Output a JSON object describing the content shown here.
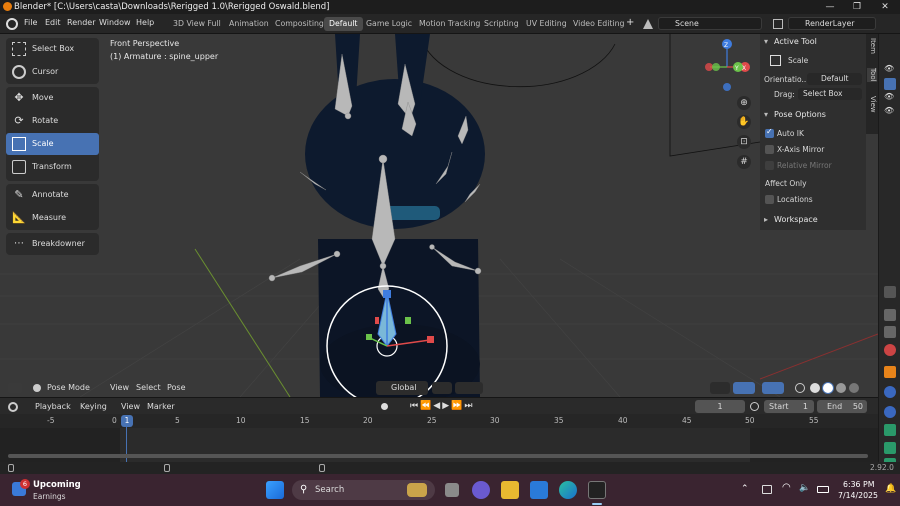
{
  "window": {
    "title": "Blender* [C:\\Users\\casta\\Downloads\\Rerigged 1.0\\Rerigged Oswald.blend]",
    "minimize": "—",
    "maximize": "❐",
    "close": "✕"
  },
  "menu": {
    "items": [
      "File",
      "Edit",
      "Render",
      "Window",
      "Help"
    ],
    "workspaces": [
      "3D View Full",
      "Animation",
      "Compositing",
      "Default",
      "Game Logic",
      "Motion Tracking",
      "Scripting",
      "UV Editing",
      "Video Editing"
    ],
    "active_workspace": "Default",
    "add_workspace": "+",
    "scene": "Scene",
    "render_layer": "RenderLayer"
  },
  "viewport": {
    "perspective": "Front Perspective",
    "object_info": "(1) Armature : spine_upper",
    "gizmo_labels": {
      "z": "Z",
      "y": "Y",
      "x": "X"
    }
  },
  "toolbar": {
    "tools": [
      "Select Box",
      "Cursor",
      "Move",
      "Rotate",
      "Scale",
      "Transform",
      "Annotate",
      "Measure",
      "Breakdowner"
    ],
    "active": "Scale"
  },
  "npanel": {
    "active_tool_header": "Active Tool",
    "tool_name": "Scale",
    "orientation_label": "Orientatio...",
    "orientation_value": "Default",
    "drag_label": "Drag:",
    "drag_value": "Select Box",
    "pose_options_header": "Pose Options",
    "auto_ik": "Auto IK",
    "x_axis_mirror": "X-Axis Mirror",
    "relative_mirror": "Relative Mirror",
    "affect_only": "Affect Only",
    "locations": "Locations",
    "workspace_header": "Workspace",
    "side_tabs": [
      "Item",
      "Tool",
      "View"
    ]
  },
  "viewport_header": {
    "mode": "Pose Mode",
    "menus": [
      "View",
      "Select",
      "Pose"
    ],
    "transform_orientation": "Global"
  },
  "timeline_header": {
    "menus": [
      "Playback",
      "Keying",
      "View",
      "Marker"
    ],
    "current_frame": "1",
    "start_label": "Start",
    "start_value": "1",
    "end_label": "End",
    "end_value": "50"
  },
  "timeline": {
    "ticks": [
      "-5",
      "0",
      "1",
      "5",
      "10",
      "15",
      "20",
      "25",
      "30",
      "35",
      "40",
      "45",
      "50",
      "55"
    ]
  },
  "statusbar": {
    "version": "2.92.0"
  },
  "taskbar": {
    "weather_title": "Upcoming",
    "weather_sub": "Earnings",
    "notification_count": "6",
    "search": "Search",
    "time": "6:36 PM",
    "date": "7/14/2025"
  },
  "colors": {
    "accent": "#4772b3",
    "viewport_bg": "#393939",
    "panel_bg": "#2f2f2f",
    "taskbar_bg": "#3a2430",
    "x_axis": "#e04a4a",
    "y_axis": "#6bc24a",
    "z_axis": "#3f7de0"
  }
}
